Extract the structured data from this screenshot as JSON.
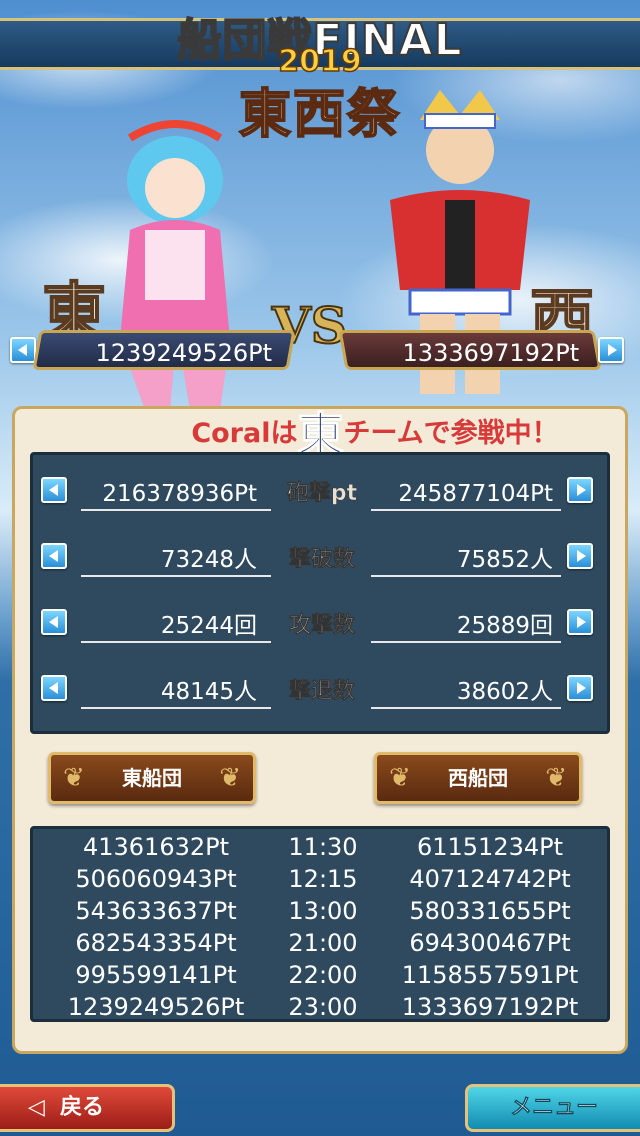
{
  "title": {
    "main": "船団戦FINAL",
    "year": "2019",
    "sub": "東西祭"
  },
  "teams": {
    "east_kanji": "東",
    "west_kanji": "西",
    "vs": "VS"
  },
  "scores": {
    "east": "1239249526Pt",
    "west": "1333697192Pt"
  },
  "team_line": {
    "player": "Coralは",
    "team": "東",
    "suffix": "チームで参戦中！"
  },
  "stats": [
    {
      "label": "砲撃pt",
      "east": "216378936Pt",
      "west": "245877104Pt"
    },
    {
      "label": "撃破数",
      "east": "73248人",
      "west": "75852人"
    },
    {
      "label": "攻撃数",
      "east": "25244回",
      "west": "25889回"
    },
    {
      "label": "撃退数",
      "east": "48145人",
      "west": "38602人"
    }
  ],
  "fleet_buttons": {
    "east": "東船団",
    "west": "西船団"
  },
  "history": [
    {
      "east": "41361632Pt",
      "time": "11:30",
      "west": "61151234Pt"
    },
    {
      "east": "506060943Pt",
      "time": "12:15",
      "west": "407124742Pt"
    },
    {
      "east": "543633637Pt",
      "time": "13:00",
      "west": "580331655Pt"
    },
    {
      "east": "682543354Pt",
      "time": "21:00",
      "west": "694300467Pt"
    },
    {
      "east": "995599141Pt",
      "time": "22:00",
      "west": "1158557591Pt"
    },
    {
      "east": "1239249526Pt",
      "time": "23:00",
      "west": "1333697192Pt"
    }
  ],
  "nav": {
    "back": "戻る",
    "menu": "メニュー"
  },
  "colors": {
    "accent_red": "#d83a3a",
    "panel_bg": "#f3ead8",
    "box_bg": "#2f4a5e"
  },
  "icons": {
    "back": "chevron-left-icon",
    "arrow_left": "triangle-left-icon",
    "arrow_right": "triangle-right-icon"
  }
}
